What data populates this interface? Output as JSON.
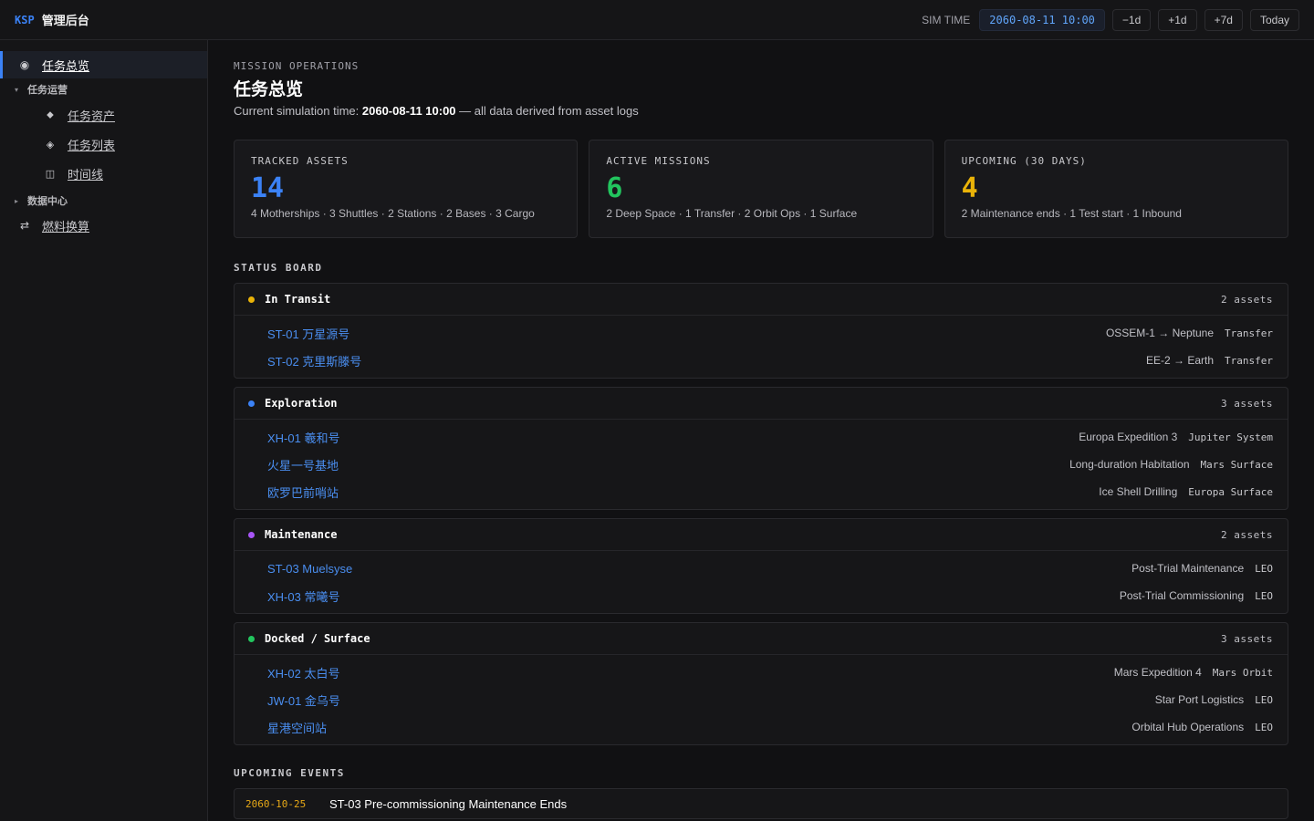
{
  "brand": {
    "short": "KSP",
    "title": "管理后台"
  },
  "sim": {
    "label": "SIM TIME",
    "time": "2060-08-11 10:00",
    "buttons": [
      "−1d",
      "+1d",
      "+7d",
      "Today"
    ]
  },
  "sidebar": {
    "overview": "任务总览",
    "ops_group": "任务运营",
    "ops_items": [
      "任务资产",
      "任务列表",
      "时间线"
    ],
    "data_group": "数据中心",
    "fuel": "燃料换算"
  },
  "header": {
    "eyebrow": "MISSION OPERATIONS",
    "title": "任务总览",
    "subtitle_prefix": "Current simulation time: ",
    "subtitle_time": "2060-08-11 10:00",
    "subtitle_suffix": " — all data derived from asset logs"
  },
  "cards": [
    {
      "label": "TRACKED ASSETS",
      "value": "14",
      "color": "#3b82f6",
      "detail": "4 Motherships · 3 Shuttles · 2 Stations · 2 Bases · 3 Cargo"
    },
    {
      "label": "ACTIVE MISSIONS",
      "value": "6",
      "color": "#22c55e",
      "detail": "2 Deep Space · 1 Transfer · 2 Orbit Ops · 1 Surface"
    },
    {
      "label": "UPCOMING (30 DAYS)",
      "value": "4",
      "color": "#eab308",
      "detail": "2 Maintenance ends · 1 Test start · 1 Inbound"
    }
  ],
  "status_board": {
    "label": "STATUS BOARD",
    "groups": [
      {
        "title": "In Transit",
        "count": "2 assets",
        "color": "#eab308",
        "rows": [
          {
            "name": "ST-01 万星源号",
            "mission": "OSSEM-1 → Neptune",
            "loc": "Transfer"
          },
          {
            "name": "ST-02 克里斯滕号",
            "mission": "EE-2 → Earth",
            "loc": "Transfer"
          }
        ]
      },
      {
        "title": "Exploration",
        "count": "3 assets",
        "color": "#3b82f6",
        "rows": [
          {
            "name": "XH-01 羲和号",
            "mission": "Europa Expedition 3",
            "loc": "Jupiter System"
          },
          {
            "name": "火星一号基地",
            "mission": "Long-duration Habitation",
            "loc": "Mars Surface"
          },
          {
            "name": "欧罗巴前哨站",
            "mission": "Ice Shell Drilling",
            "loc": "Europa Surface"
          }
        ]
      },
      {
        "title": "Maintenance",
        "count": "2 assets",
        "color": "#a855f7",
        "rows": [
          {
            "name": "ST-03 Muelsyse",
            "mission": "Post-Trial Maintenance",
            "loc": "LEO"
          },
          {
            "name": "XH-03 常曦号",
            "mission": "Post-Trial Commissioning",
            "loc": "LEO"
          }
        ]
      },
      {
        "title": "Docked / Surface",
        "count": "3 assets",
        "color": "#22c55e",
        "rows": [
          {
            "name": "XH-02 太白号",
            "mission": "Mars Expedition 4",
            "loc": "Mars Orbit"
          },
          {
            "name": "JW-01 金乌号",
            "mission": "Star Port Logistics",
            "loc": "LEO"
          },
          {
            "name": "星港空间站",
            "mission": "Orbital Hub Operations",
            "loc": "LEO"
          }
        ]
      }
    ]
  },
  "upcoming": {
    "label": "UPCOMING EVENTS",
    "events": [
      {
        "date": "2060-10-25",
        "title": "ST-03 Pre-commissioning Maintenance Ends"
      }
    ]
  }
}
